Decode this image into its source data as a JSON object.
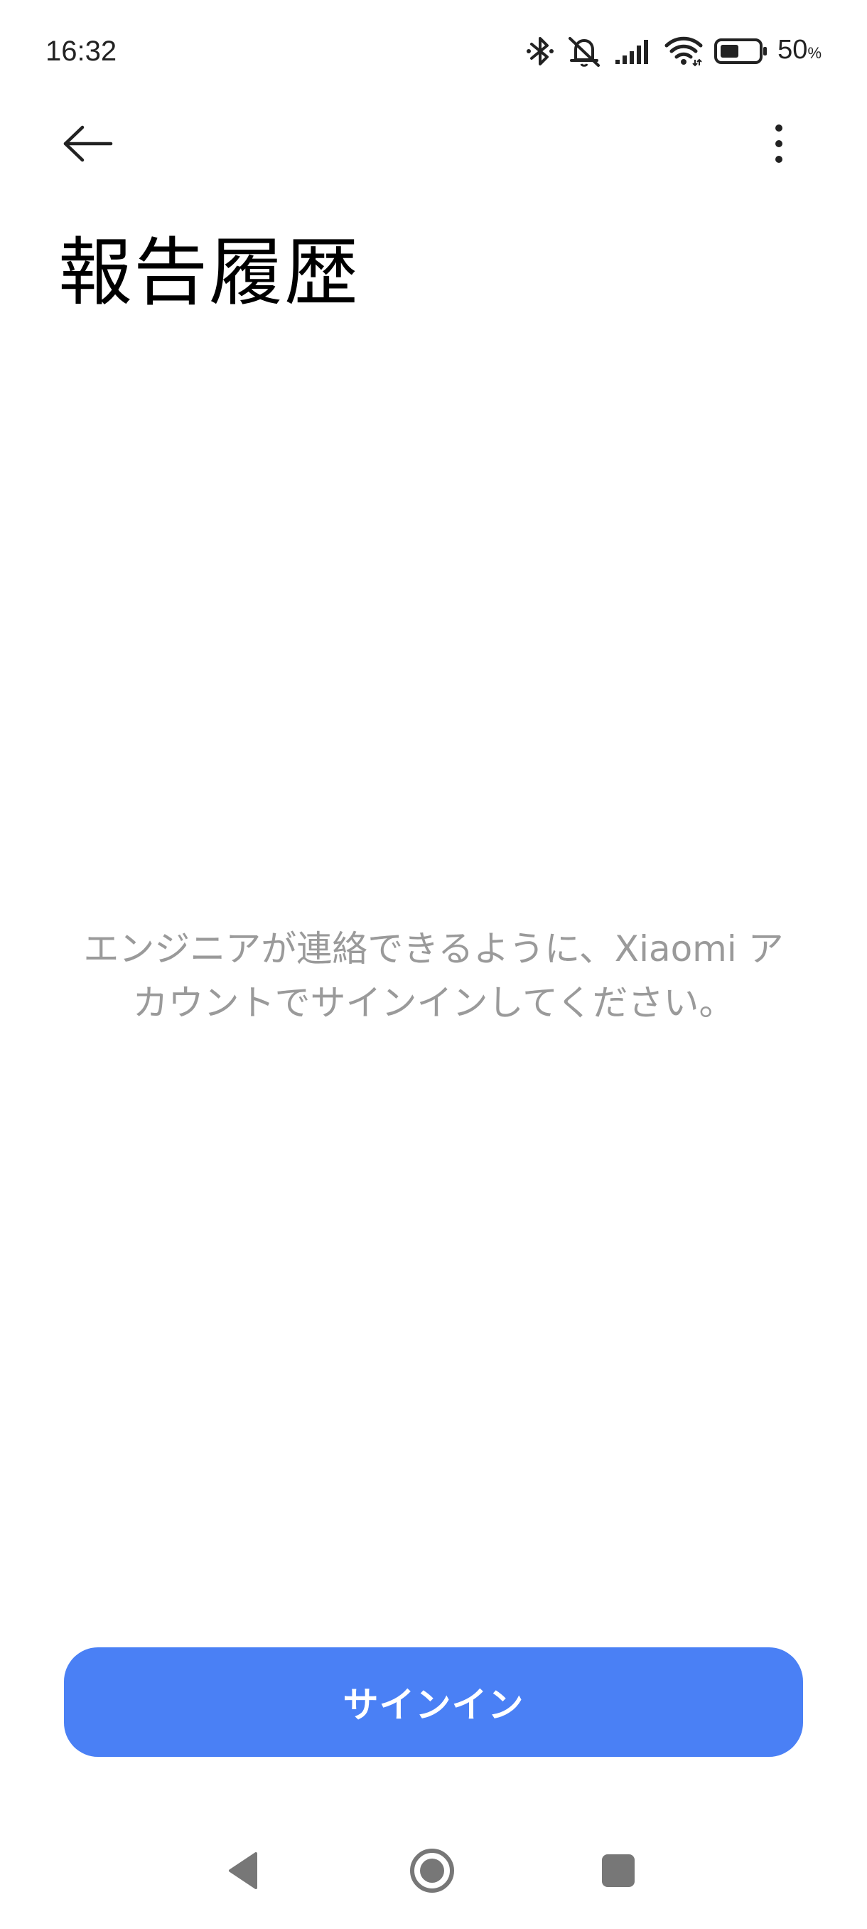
{
  "status_bar": {
    "time": "16:32",
    "battery_percent": "50",
    "battery_unit": "%",
    "battery_level": 0.5,
    "icons": [
      "bluetooth-icon",
      "bell-muted-icon",
      "cellular-signal-icon",
      "wifi-icon",
      "battery-icon"
    ]
  },
  "app_bar": {
    "back_icon": "arrow-left-icon",
    "more_icon": "more-vert-icon"
  },
  "page": {
    "title": "報告履歴",
    "empty_message_line1": "エンジニアが連絡できるように、Xiaomi ア",
    "empty_message_line2": "カウントでサインインしてください。"
  },
  "actions": {
    "signin_label": "サインイン"
  },
  "nav_bar": {
    "icons": [
      "nav-back-icon",
      "nav-home-icon",
      "nav-recents-icon"
    ]
  },
  "colors": {
    "accent": "#4a80f5",
    "message_text": "#9a9a9a",
    "background": "#ffffff"
  }
}
